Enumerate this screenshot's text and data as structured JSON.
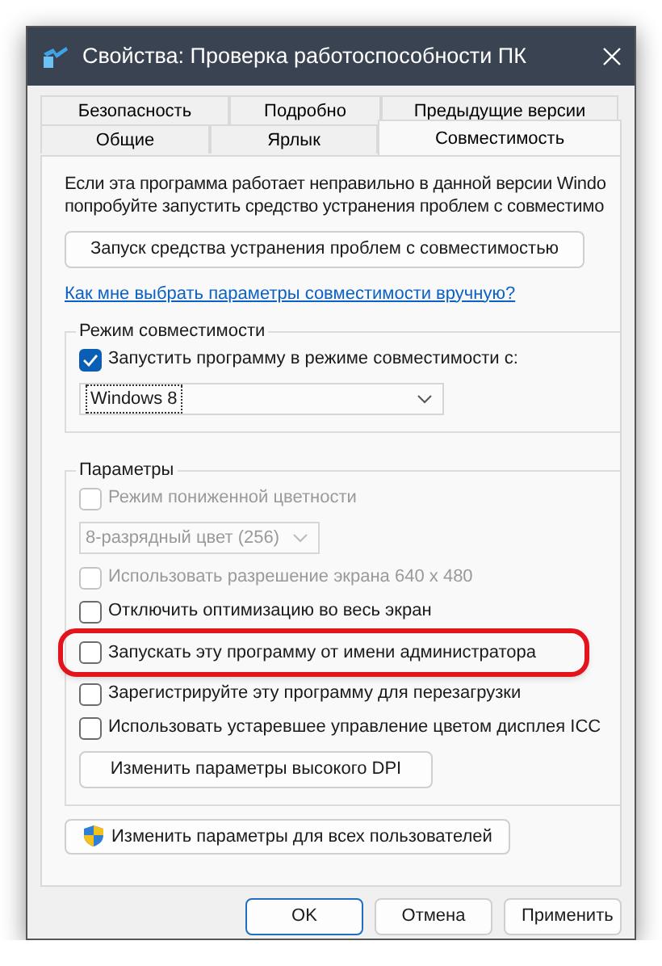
{
  "window": {
    "title": "Свойства: Проверка работоспособности ПК"
  },
  "tab_rows": [
    [
      {
        "label": "Безопасность",
        "selected": false
      },
      {
        "label": "Подробно",
        "selected": false
      },
      {
        "label": "Предыдущие версии",
        "selected": false
      }
    ],
    [
      {
        "label": "Общие",
        "selected": false
      },
      {
        "label": "Ярлык",
        "selected": false
      },
      {
        "label": "Совместимость",
        "selected": true
      }
    ]
  ],
  "description_lines": [
    "Если эта программа работает неправильно в данной версии Windo",
    "попробуйте запустить средство устранения проблем с совместимо"
  ],
  "troubleshooter_button": "Запуск средства устранения проблем с совместимостью",
  "help_link": "Как мне выбрать параметры совместимости вручную?",
  "compat_mode": {
    "title": "Режим совместимости",
    "checkbox": {
      "label": "Запустить программу в режиме совместимости с:",
      "checked": true
    },
    "select": {
      "value": "Windows 8"
    }
  },
  "settings": {
    "title": "Параметры",
    "options": [
      {
        "kind": "checkbox",
        "label": "Режим пониженной цветности",
        "checked": false,
        "disabled": true,
        "highlighted": false
      },
      {
        "kind": "select",
        "label": "8-разрядный цвет (256)",
        "disabled": true
      },
      {
        "kind": "checkbox",
        "label": "Использовать разрешение экрана 640 x 480",
        "checked": false,
        "disabled": true,
        "highlighted": false
      },
      {
        "kind": "checkbox",
        "label": "Отключить оптимизацию во весь экран",
        "checked": false,
        "disabled": false,
        "highlighted": false
      },
      {
        "kind": "checkbox",
        "label": "Запускать эту программу от имени администратора",
        "checked": false,
        "disabled": false,
        "highlighted": true
      },
      {
        "kind": "checkbox",
        "label": "Зарегистрируйте эту программу для перезагрузки",
        "checked": false,
        "disabled": false,
        "highlighted": false
      },
      {
        "kind": "checkbox",
        "label": "Использовать устаревшее управление цветом дисплея ICC",
        "checked": false,
        "disabled": false,
        "highlighted": false
      },
      {
        "kind": "button",
        "label": "Изменить параметры высокого DPI"
      }
    ]
  },
  "all_users_button": "Изменить параметры для всех пользователей",
  "buttons": [
    "OK",
    "Отмена",
    "Применить"
  ]
}
